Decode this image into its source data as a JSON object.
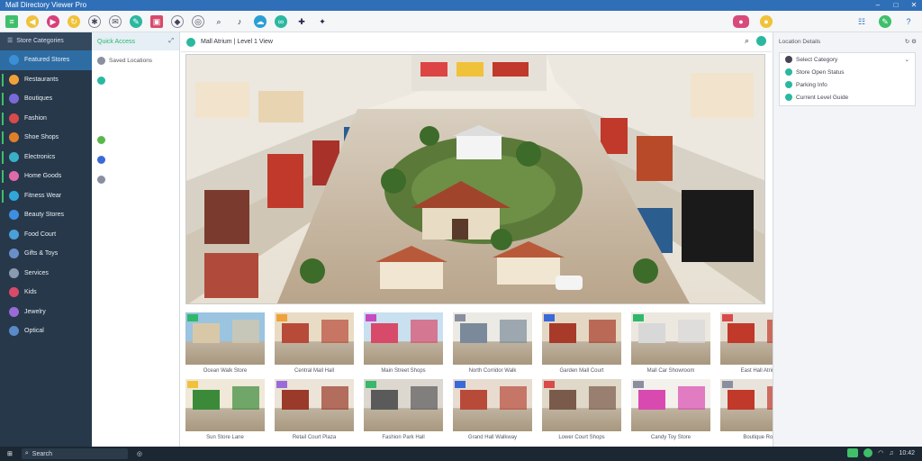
{
  "window": {
    "title": "Mall Directory Viewer Pro"
  },
  "toolbar": {
    "icons": [
      "menu-icon",
      "back-icon",
      "forward-icon",
      "refresh-icon",
      "tag-icon",
      "chat-icon",
      "edit-icon",
      "image-icon",
      "puzzle-icon",
      "share-icon",
      "search-icon",
      "bell-icon",
      "cloud-icon",
      "link-icon",
      "pin-icon",
      "star-icon"
    ],
    "right_icons": [
      "record-icon",
      "coin-icon",
      "grid-icon",
      "edit-icon",
      "help-icon"
    ]
  },
  "sidebar": {
    "header": "Store Categories",
    "items": [
      {
        "label": "Featured Stores",
        "icon": "home-icon",
        "color": "#3a8fd6",
        "active": true
      },
      {
        "label": "Restaurants",
        "icon": "dining-icon",
        "color": "#f0a23a"
      },
      {
        "label": "Boutiques",
        "icon": "hanger-icon",
        "color": "#7a6ad8"
      },
      {
        "label": "Fashion",
        "icon": "shirt-icon",
        "color": "#d94a4a"
      },
      {
        "label": "Shoe Shops",
        "icon": "shoe-icon",
        "color": "#e07f2a"
      },
      {
        "label": "Electronics",
        "icon": "chip-icon",
        "color": "#3ab0c8"
      },
      {
        "label": "Home Goods",
        "icon": "sofa-icon",
        "color": "#e26aa8"
      },
      {
        "label": "Fitness Wear",
        "icon": "run-icon",
        "color": "#2fa7d8"
      },
      {
        "label": "Beauty Stores",
        "icon": "lipstick-icon",
        "color": "#3f8fe0"
      },
      {
        "label": "Food Court",
        "icon": "cup-icon",
        "color": "#4aa0d8"
      },
      {
        "label": "Gifts & Toys",
        "icon": "gift-icon",
        "color": "#6a8fc8"
      },
      {
        "label": "Services",
        "icon": "wrench-icon",
        "color": "#8a9ab0"
      },
      {
        "label": "Kids",
        "icon": "balloon-icon",
        "color": "#d84a6a"
      },
      {
        "label": "Jewelry",
        "icon": "gem-icon",
        "color": "#9a6ad8"
      },
      {
        "label": "Optical",
        "icon": "glasses-icon",
        "color": "#5a8ac8"
      }
    ]
  },
  "panel2": {
    "header": "Quick Access",
    "rows": [
      {
        "label": "Saved Locations",
        "icon": "bookmark-icon",
        "color": "#8a8fa0"
      },
      {
        "label": "",
        "icon": "sync-icon",
        "color": "#2ab8a0"
      },
      {
        "label": "",
        "icon": "spacer",
        "color": "transparent"
      },
      {
        "label": "",
        "icon": "spacer",
        "color": "transparent"
      },
      {
        "label": "",
        "icon": "leaf-icon",
        "color": "#5ab84a"
      },
      {
        "label": "",
        "icon": "flag-icon",
        "color": "#3a6ad8"
      },
      {
        "label": "",
        "icon": "moon-icon",
        "color": "#8a8fa0"
      }
    ]
  },
  "main": {
    "title": "Mall Atrium | Level 1 View",
    "hero_alt": "Mall atrium overhead view",
    "thumbs": [
      {
        "caption": "Ocean Walk Store",
        "tag": "#2fb86a"
      },
      {
        "caption": "Central Mall Hall",
        "tag": "#f0a23a"
      },
      {
        "caption": "Main Street Shops",
        "tag": "#c84ac0"
      },
      {
        "caption": "North Corridor Walk",
        "tag": "#8a8fa0"
      },
      {
        "caption": "Garden Mall Court",
        "tag": "#3a6ad8"
      },
      {
        "caption": "Mall Car Showroom",
        "tag": "#2fb86a"
      },
      {
        "caption": "East Hall Atrium",
        "tag": "#d94a4a"
      },
      {
        "caption": "Sun Store Lane",
        "tag": "#f0c23a"
      },
      {
        "caption": "Retail Court Plaza",
        "tag": "#9a6ad8"
      },
      {
        "caption": "Fashion Park Hall",
        "tag": "#3ab86a"
      },
      {
        "caption": "Grand Hall Walkway",
        "tag": "#3a6ad8"
      },
      {
        "caption": "Lower Court Shops",
        "tag": "#d94a4a"
      },
      {
        "caption": "Candy Toy Store",
        "tag": "#8a8fa0"
      },
      {
        "caption": "Boutique Row",
        "tag": "#8a8fa0"
      }
    ]
  },
  "right": {
    "header": "Location Details",
    "rows": [
      {
        "label": "Select Category",
        "color": "#445"
      },
      {
        "label": "Store Open Status",
        "color": "#2ab8a0"
      },
      {
        "label": "Parking Info",
        "color": "#2ab8a0"
      },
      {
        "label": "Current Level Guide",
        "color": "#2ab8a0"
      }
    ]
  },
  "taskbar": {
    "search": "Search",
    "time": "10:42"
  }
}
